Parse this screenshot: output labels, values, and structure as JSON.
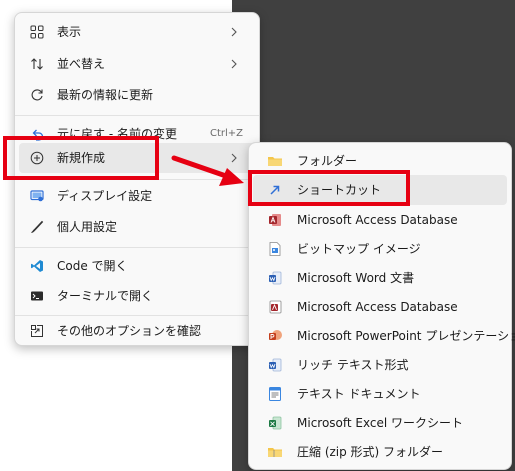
{
  "context_menu": {
    "items": [
      {
        "label": "表示",
        "icon": "grid-view-icon",
        "has_submenu": true
      },
      {
        "label": "並べ替え",
        "icon": "sort-icon",
        "has_submenu": true
      },
      {
        "label": "最新の情報に更新",
        "icon": "refresh-icon"
      },
      {
        "label": "元に戻す - 名前の変更",
        "icon": "undo-icon",
        "shortcut": "Ctrl+Z"
      },
      {
        "label": "新規作成",
        "icon": "new-plus-icon",
        "has_submenu": true,
        "selected": true
      },
      {
        "label": "ディスプレイ設定",
        "icon": "display-settings-icon"
      },
      {
        "label": "個人用設定",
        "icon": "personalize-brush-icon"
      },
      {
        "label": "Code で開く",
        "icon": "vscode-icon"
      },
      {
        "label": "ターミナルで開く",
        "icon": "terminal-icon"
      },
      {
        "label": "その他のオプションを確認",
        "icon": "more-options-icon"
      }
    ]
  },
  "submenu": {
    "items": [
      {
        "label": "フォルダー",
        "icon": "folder-icon"
      },
      {
        "label": "ショートカット",
        "icon": "shortcut-arrow-icon",
        "hover": true
      },
      {
        "label": "Microsoft Access Database",
        "icon": "access-db-icon"
      },
      {
        "label": "ビットマップ イメージ",
        "icon": "bitmap-image-icon"
      },
      {
        "label": "Microsoft Word 文書",
        "icon": "word-document-icon"
      },
      {
        "label": "Microsoft Access Database",
        "icon": "access-db-icon"
      },
      {
        "label": "Microsoft PowerPoint プレゼンテーション",
        "icon": "powerpoint-icon"
      },
      {
        "label": "リッチ テキスト形式",
        "icon": "rich-text-icon"
      },
      {
        "label": "テキスト ドキュメント",
        "icon": "text-document-icon"
      },
      {
        "label": "Microsoft Excel ワークシート",
        "icon": "excel-icon"
      },
      {
        "label": "圧縮 (zip 形式) フォルダー",
        "icon": "zip-folder-icon"
      }
    ]
  },
  "colors": {
    "annotation_red": "#e60012",
    "menu_bg": "#f9f9f9",
    "desktop_dark": "#404040",
    "hover": "#e8e8e8"
  }
}
